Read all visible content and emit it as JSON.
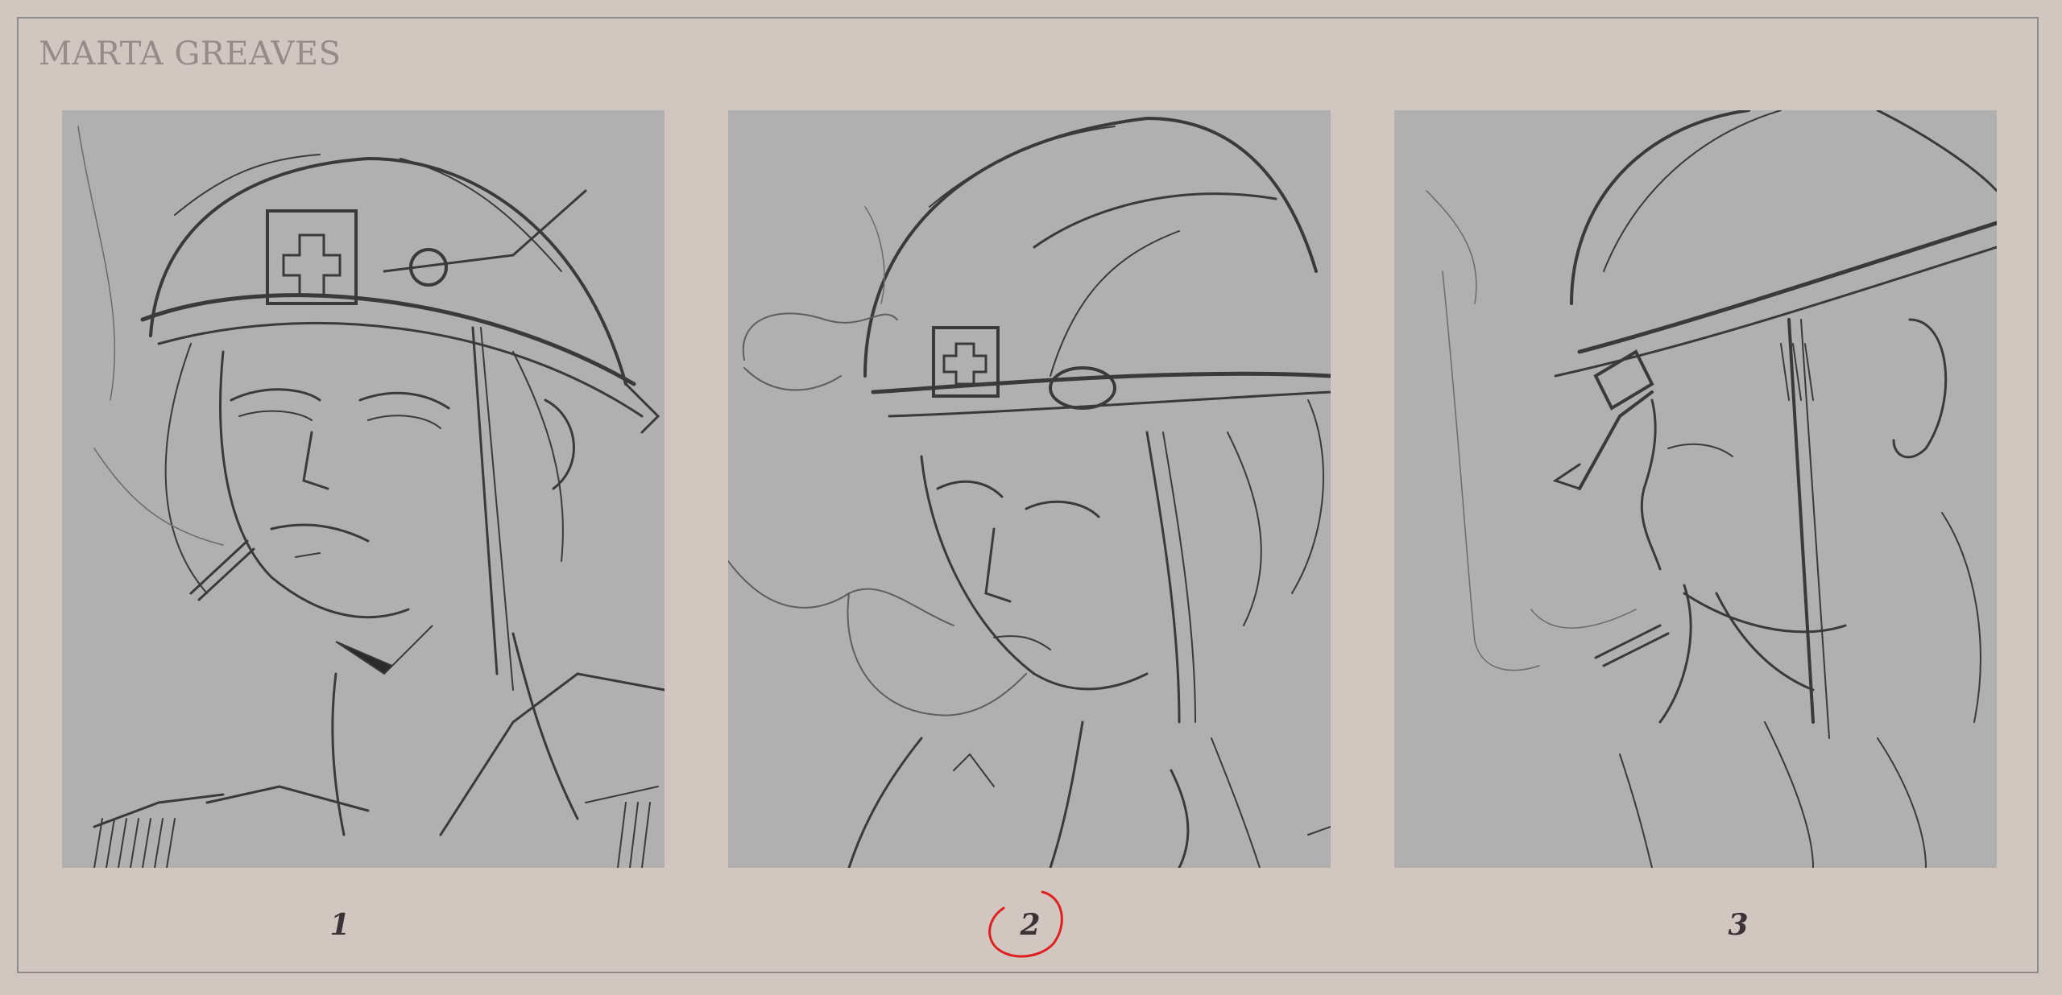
{
  "sheet": {
    "title": "MARTA GREAVES"
  },
  "panels": [
    {
      "number": "1",
      "selected": false
    },
    {
      "number": "2",
      "selected": true
    },
    {
      "number": "3",
      "selected": false
    }
  ],
  "colors": {
    "background": "#d2c6c1",
    "panel": "#b0b0b0",
    "sketch_line": "#3a3a3a",
    "selection_mark": "#e02020",
    "title": "#958b88"
  }
}
